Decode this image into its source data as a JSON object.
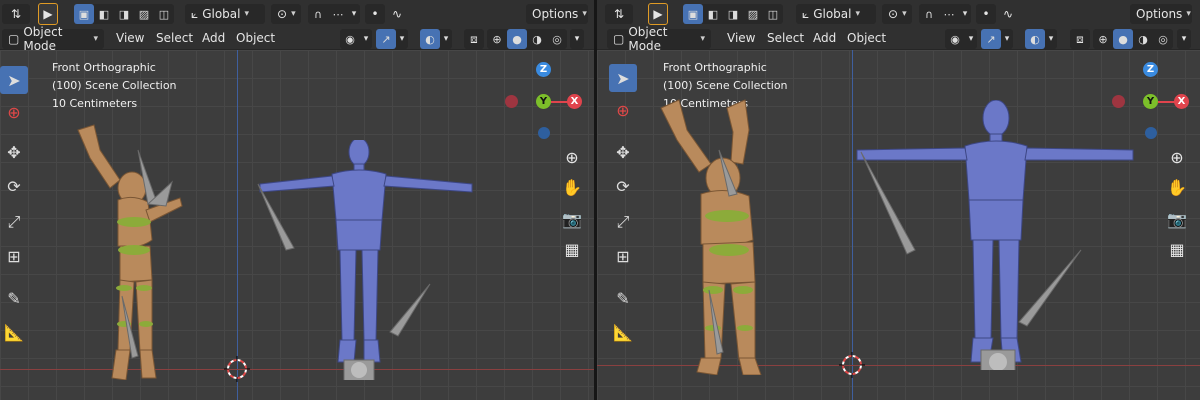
{
  "toolbar": {
    "orientation_label": "Global",
    "options_label": "Options"
  },
  "header": {
    "mode_label": "Object Mode",
    "menu": [
      "View",
      "Select",
      "Add",
      "Object"
    ]
  },
  "viewport": {
    "view_name": "Front Orthographic",
    "collection": "(100) Scene Collection",
    "scale": "10 Centimeters"
  },
  "gizmo": {
    "z": "Z",
    "y": "Y",
    "x": "X"
  },
  "colors": {
    "accent": "#4772b3",
    "active_outline": "#e09b25",
    "axis_x": "#e0444d",
    "axis_y": "#7cbf2a",
    "axis_z": "#3a8be0",
    "mannequin_orange": "#b98a5c",
    "mannequin_blue": "#6b78c8"
  },
  "icons": [
    "transform-icon",
    "select-box-icon",
    "cursor-icon",
    "move-icon",
    "rotate-icon",
    "scale-icon",
    "transform-all-icon",
    "annotate-icon",
    "measure-icon",
    "zoom-icon",
    "hand-icon",
    "camera-icon",
    "grid-icon",
    "eye-icon",
    "shading-wireframe-icon",
    "shading-solid-icon",
    "shading-material-icon",
    "shading-rendered-icon"
  ]
}
